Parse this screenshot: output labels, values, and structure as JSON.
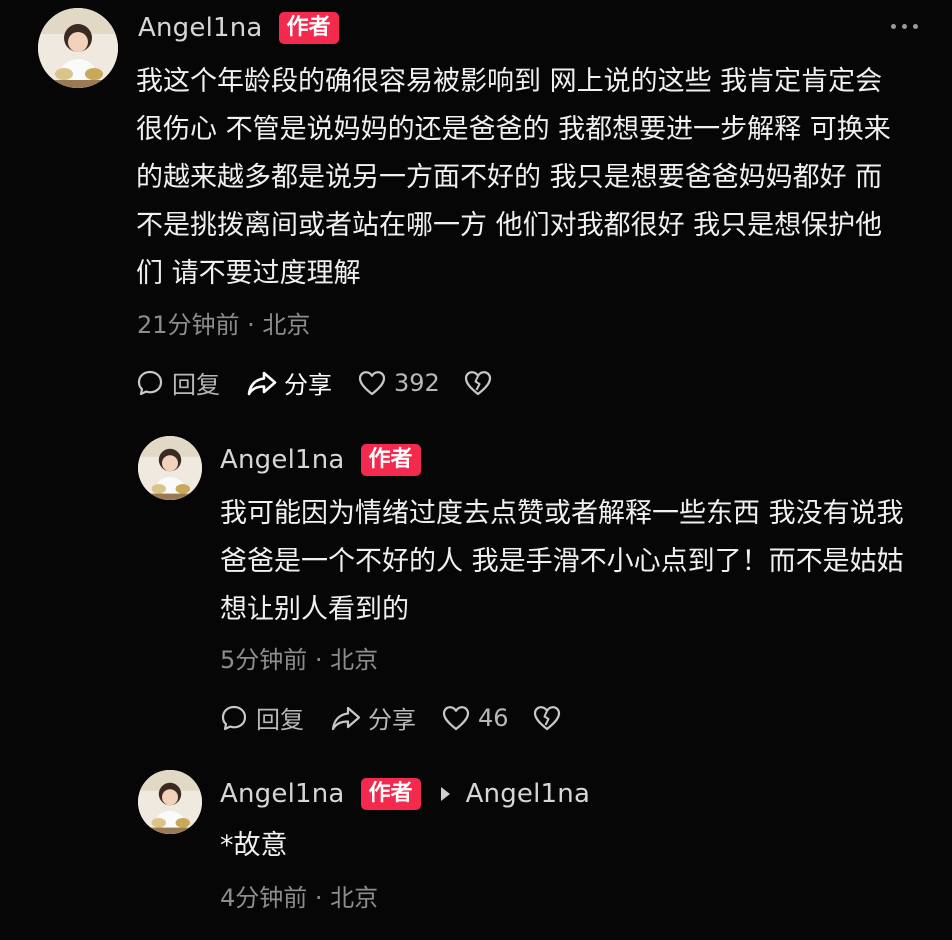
{
  "comments": [
    {
      "username": "Angel1na",
      "badge": "作者",
      "text": "我这个年龄段的确很容易被影响到 网上说的这些 我肯定肯定会很伤心 不管是说妈妈的还是爸爸的 我都想要进一步解释 可换来的越来越多都是说另一方面不好的 我只是想要爸爸妈妈都好 而不是挑拨离间或者站在哪一方 他们对我都很好 我只是想保护他们 请不要过度理解",
      "meta": "21分钟前 · 北京",
      "reply_label": "回复",
      "share_label": "分享",
      "likes": "392"
    },
    {
      "username": "Angel1na",
      "badge": "作者",
      "text": "我可能因为情绪过度去点赞或者解释一些东西 我没有说我爸爸是一个不好的人 我是手滑不小心点到了！而不是姑姑想让别人看到的",
      "meta": "5分钟前 · 北京",
      "reply_label": "回复",
      "share_label": "分享",
      "likes": "46"
    },
    {
      "username": "Angel1na",
      "badge": "作者",
      "reply_to": "Angel1na",
      "text": "*故意",
      "meta": "4分钟前 · 北京"
    }
  ],
  "colors": {
    "background": "#060606",
    "badge": "#f3294d",
    "meta": "#8d8d8d"
  },
  "icons": [
    "more-icon",
    "comment-bubble-icon",
    "share-arrow-icon",
    "heart-icon",
    "broken-heart-icon",
    "reply-arrow-icon"
  ]
}
